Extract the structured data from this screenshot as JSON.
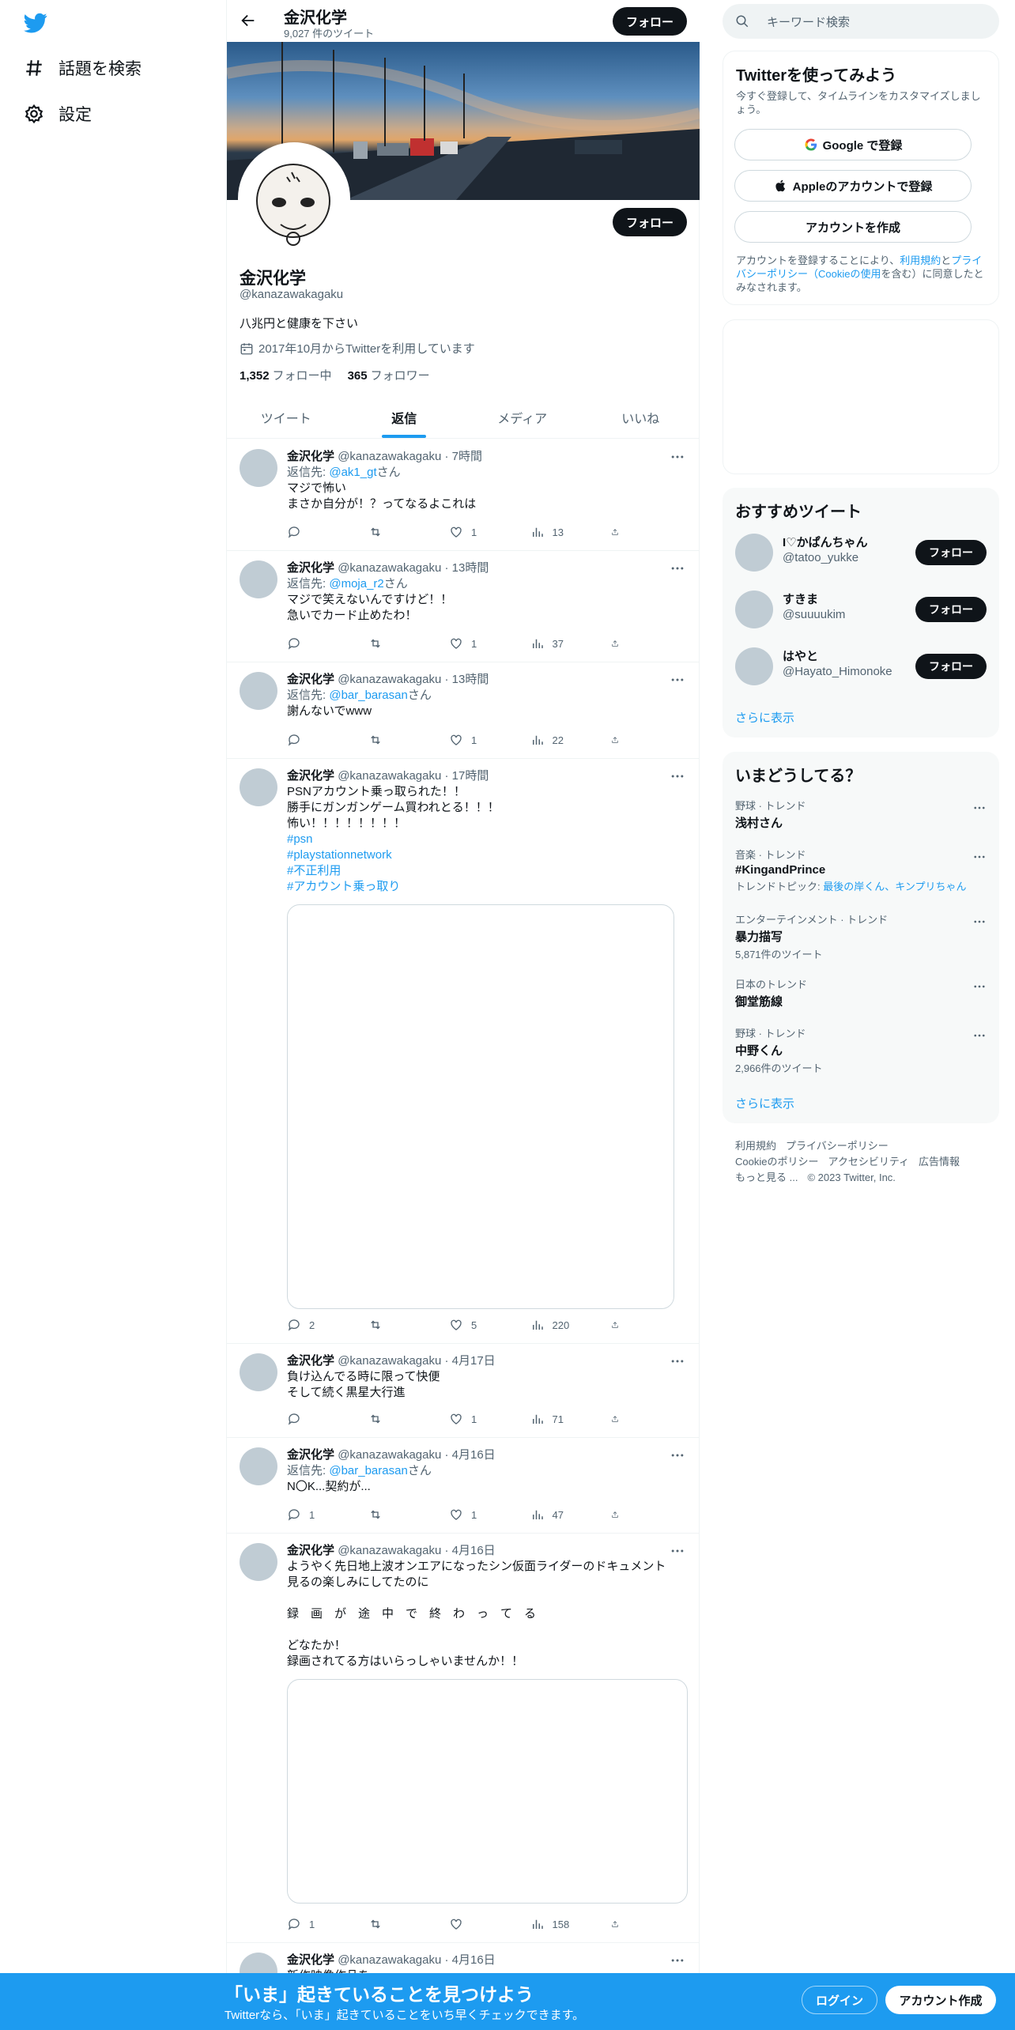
{
  "nav": {
    "items": [
      {
        "label": "話題を検索",
        "icon": "hashtag-icon"
      },
      {
        "label": "設定",
        "icon": "gear-icon"
      }
    ]
  },
  "header": {
    "name": "金沢化学",
    "tweet_count": "9,027 件のツイート",
    "follow_label": "フォロー"
  },
  "profile": {
    "name": "金沢化学",
    "handle": "@kanazawakagaku",
    "bio": "八兆円と健康を下さい",
    "joined": "2017年10月からTwitterを利用しています",
    "following_count": "1,352",
    "following_label": "フォロー中",
    "followers_count": "365",
    "followers_label": "フォロワー",
    "follow_label": "フォロー"
  },
  "tabs": [
    "ツイート",
    "返信",
    "メディア",
    "いいね"
  ],
  "tweets": [
    {
      "name": "金沢化学",
      "meta": "@kanazawakagaku · 7時間",
      "reply_prefix": "返信先: ",
      "reply_to": "@ak1_gt",
      "reply_suffix": "さん",
      "lines": [
        "マジで怖い",
        "まさか自分が！？ってなるよこれは"
      ],
      "replies": "",
      "retweets": "",
      "likes": "1",
      "views": "13"
    },
    {
      "name": "金沢化学",
      "meta": "@kanazawakagaku · 13時間",
      "reply_prefix": "返信先: ",
      "reply_to": "@moja_r2",
      "reply_suffix": "さん",
      "lines": [
        "マジで笑えないんですけど！！",
        "急いでカード止めたわ！"
      ],
      "replies": "",
      "retweets": "",
      "likes": "1",
      "views": "37"
    },
    {
      "name": "金沢化学",
      "meta": "@kanazawakagaku · 13時間",
      "reply_prefix": "返信先: ",
      "reply_to": "@bar_barasan",
      "reply_suffix": "さん",
      "lines": [
        "謝んないでwww"
      ],
      "replies": "",
      "retweets": "",
      "likes": "1",
      "views": "22"
    },
    {
      "name": "金沢化学",
      "meta": "@kanazawakagaku · 17時間",
      "lines": [
        "PSNアカウント乗っ取られた！！",
        "勝手にガンガンゲーム買われとる！！！",
        "怖い！！！！！！！！"
      ],
      "hashtags": [
        "#psn",
        "#playstationnetwork",
        "#不正利用",
        "#アカウント乗っ取り"
      ],
      "replies": "2",
      "retweets": "",
      "likes": "5",
      "views": "220"
    },
    {
      "name": "金沢化学",
      "meta": "@kanazawakagaku · 4月17日",
      "lines": [
        "負け込んでる時に限って快便",
        "そして続く黒星大行進"
      ],
      "replies": "",
      "retweets": "",
      "likes": "1",
      "views": "71"
    },
    {
      "name": "金沢化学",
      "meta": "@kanazawakagaku · 4月16日",
      "reply_prefix": "返信先: ",
      "reply_to": "@bar_barasan",
      "reply_suffix": "さん",
      "lines": [
        "N〇K...契約が..."
      ],
      "replies": "1",
      "retweets": "",
      "likes": "1",
      "views": "47"
    },
    {
      "name": "金沢化学",
      "meta": "@kanazawakagaku · 4月16日",
      "lines": [
        "ようやく先日地上波オンエアになったシン仮面ライダーのドキュメント",
        "見るの楽しみにしてたのに",
        "",
        "録　画　が　途　中　で　終　わ　っ　て　る",
        "",
        "どなたか！",
        "録画されてる方はいらっしゃいませんか！！"
      ],
      "replies": "1",
      "retweets": "",
      "likes": "",
      "views": "158"
    },
    {
      "name": "金沢化学",
      "meta": "@kanazawakagaku · 4月16日",
      "lines": [
        "新作映像作品を..."
      ]
    }
  ],
  "right": {
    "search_placeholder": "キーワード検索",
    "signup": {
      "title": "Twitterを使ってみよう",
      "subtitle": "今すぐ登録して、タイムラインをカスタマイズしましょう。",
      "google_label": "Google で登録",
      "apple_label": "Appleのアカウントで登録",
      "create_label": "アカウントを作成",
      "terms_before": "アカウントを登録することにより、",
      "terms_link1": "利用規約",
      "terms_and": "と",
      "terms_link2": "プライバシーポリシー（Cookieの使用",
      "terms_after": "を含む）に同意したとみなされます。"
    },
    "recommend": {
      "title": "おすすめツイート",
      "users": [
        {
          "name": "I♡かぱんちゃん",
          "handle": "@tatoo_yukke",
          "button": "フォロー"
        },
        {
          "name": "すきま",
          "handle": "@suuuukim",
          "button": "フォロー"
        },
        {
          "name": "はやと",
          "handle": "@Hayato_Himonoke",
          "button": "フォロー"
        }
      ],
      "more": "さらに表示"
    },
    "trends": {
      "title": "いまどうしてる？",
      "items": [
        {
          "category": "野球 · トレンド",
          "name": "浅村さん",
          "sub": ""
        },
        {
          "category": "音楽 · トレンド",
          "name": "#KingandPrince",
          "sub_prefix": "トレンドトピック: ",
          "sub_link": "最後の岸くん、キンプリちゃん"
        },
        {
          "category": "エンターテインメント · トレンド",
          "name": "暴力描写",
          "sub": "5,871件のツイート"
        },
        {
          "category": "日本のトレンド",
          "name": "御堂筋線",
          "sub": ""
        },
        {
          "category": "野球 · トレンド",
          "name": "中野くん",
          "sub": "2,966件のツイート"
        }
      ],
      "more": "さらに表示"
    },
    "footer": {
      "links": [
        "利用規約",
        "プライバシーポリシー",
        "Cookieのポリシー",
        "アクセシビリティ",
        "広告情報",
        "もっと見る ...",
        "© 2023 Twitter, Inc."
      ]
    }
  },
  "bottombar": {
    "title": "「いま」起きていることを見つけよう",
    "subtitle": "Twitterなら、「いま」起きていることをいち早くチェックできます。",
    "login": "ログイン",
    "signup": "アカウント作成"
  },
  "colors": {
    "accent": "#1d9bf0",
    "dark_button": "#0f1419",
    "muted": "#536471"
  }
}
